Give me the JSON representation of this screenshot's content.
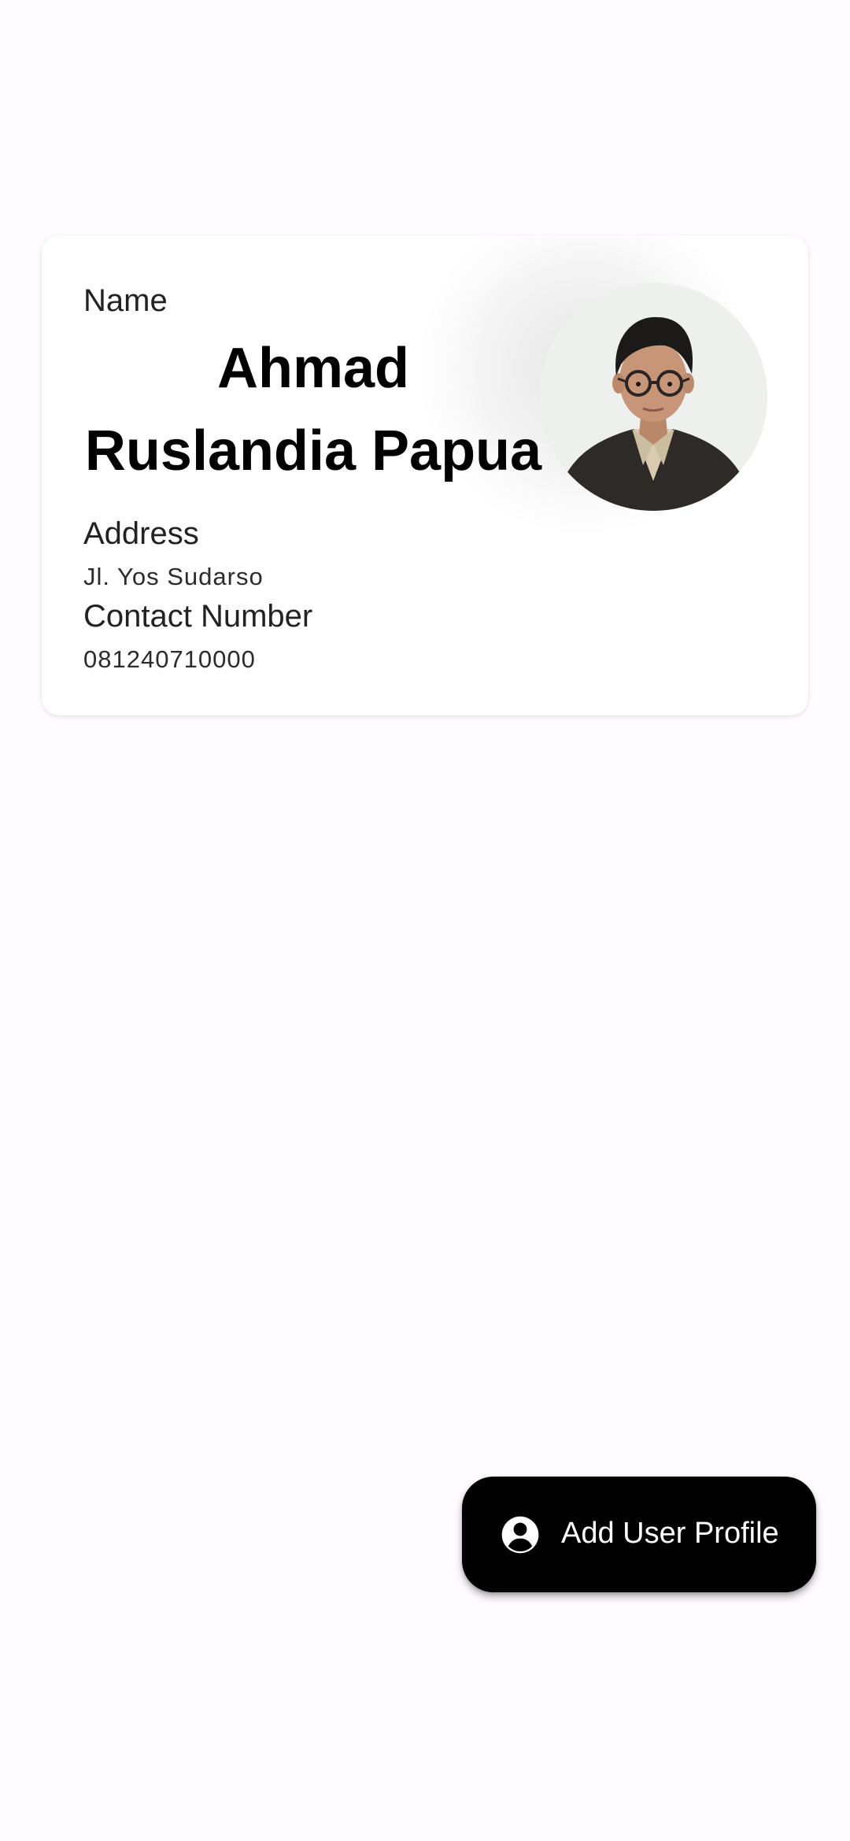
{
  "profile": {
    "name_label": "Name",
    "full_name": "Ahmad\nRuslandia Papua",
    "address_label": "Address",
    "address_value": "Jl. Yos Sudarso",
    "contact_label": "Contact Number",
    "contact_value": "081240710000",
    "photo": "profile-photo"
  },
  "fab": {
    "label": "Add User Profile",
    "icon": "account-circle-icon"
  },
  "colors": {
    "background": "#fffbfe",
    "card": "#ffffff",
    "fab_background": "#000000",
    "fab_text": "#ffffff"
  }
}
